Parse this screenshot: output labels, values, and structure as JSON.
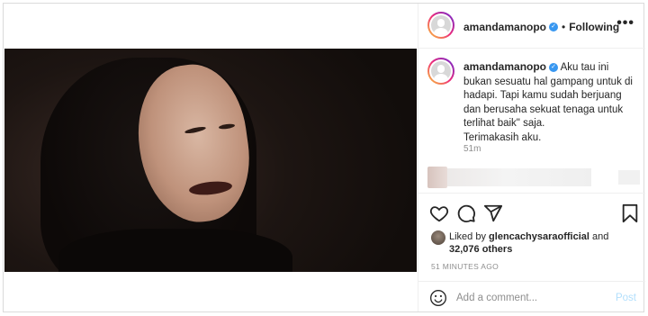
{
  "post": {
    "author": "amandamanopo",
    "follow_separator": "•",
    "follow_state": "Following",
    "more_glyph": "•••",
    "verified_glyph": "✓"
  },
  "caption": {
    "author": "amandamanopo",
    "lines": [
      "Aku tau ini bukan sesuatu hal gampang untuk di hadapi. Tapi kamu sudah berjuang dan berusaha sekuat tenaga untuk terlihat baik\" saja.",
      "Terimakasih aku."
    ],
    "time": "51m"
  },
  "likes": {
    "prefix": "Liked by",
    "liker": "glencachysaraofficial",
    "conjunction": "and",
    "count": "32,076 others"
  },
  "posted_time": "51 MINUTES AGO",
  "comment_box": {
    "placeholder": "Add a comment...",
    "post_label": "Post"
  },
  "colors": {
    "verified": "#3897f0",
    "post_disabled": "#b2dffc",
    "secondary_text": "#8e8e8e"
  },
  "icons": [
    "heart-icon",
    "comment-icon",
    "share-icon",
    "bookmark-icon",
    "smiley-icon",
    "more-icon",
    "verified-icon"
  ]
}
